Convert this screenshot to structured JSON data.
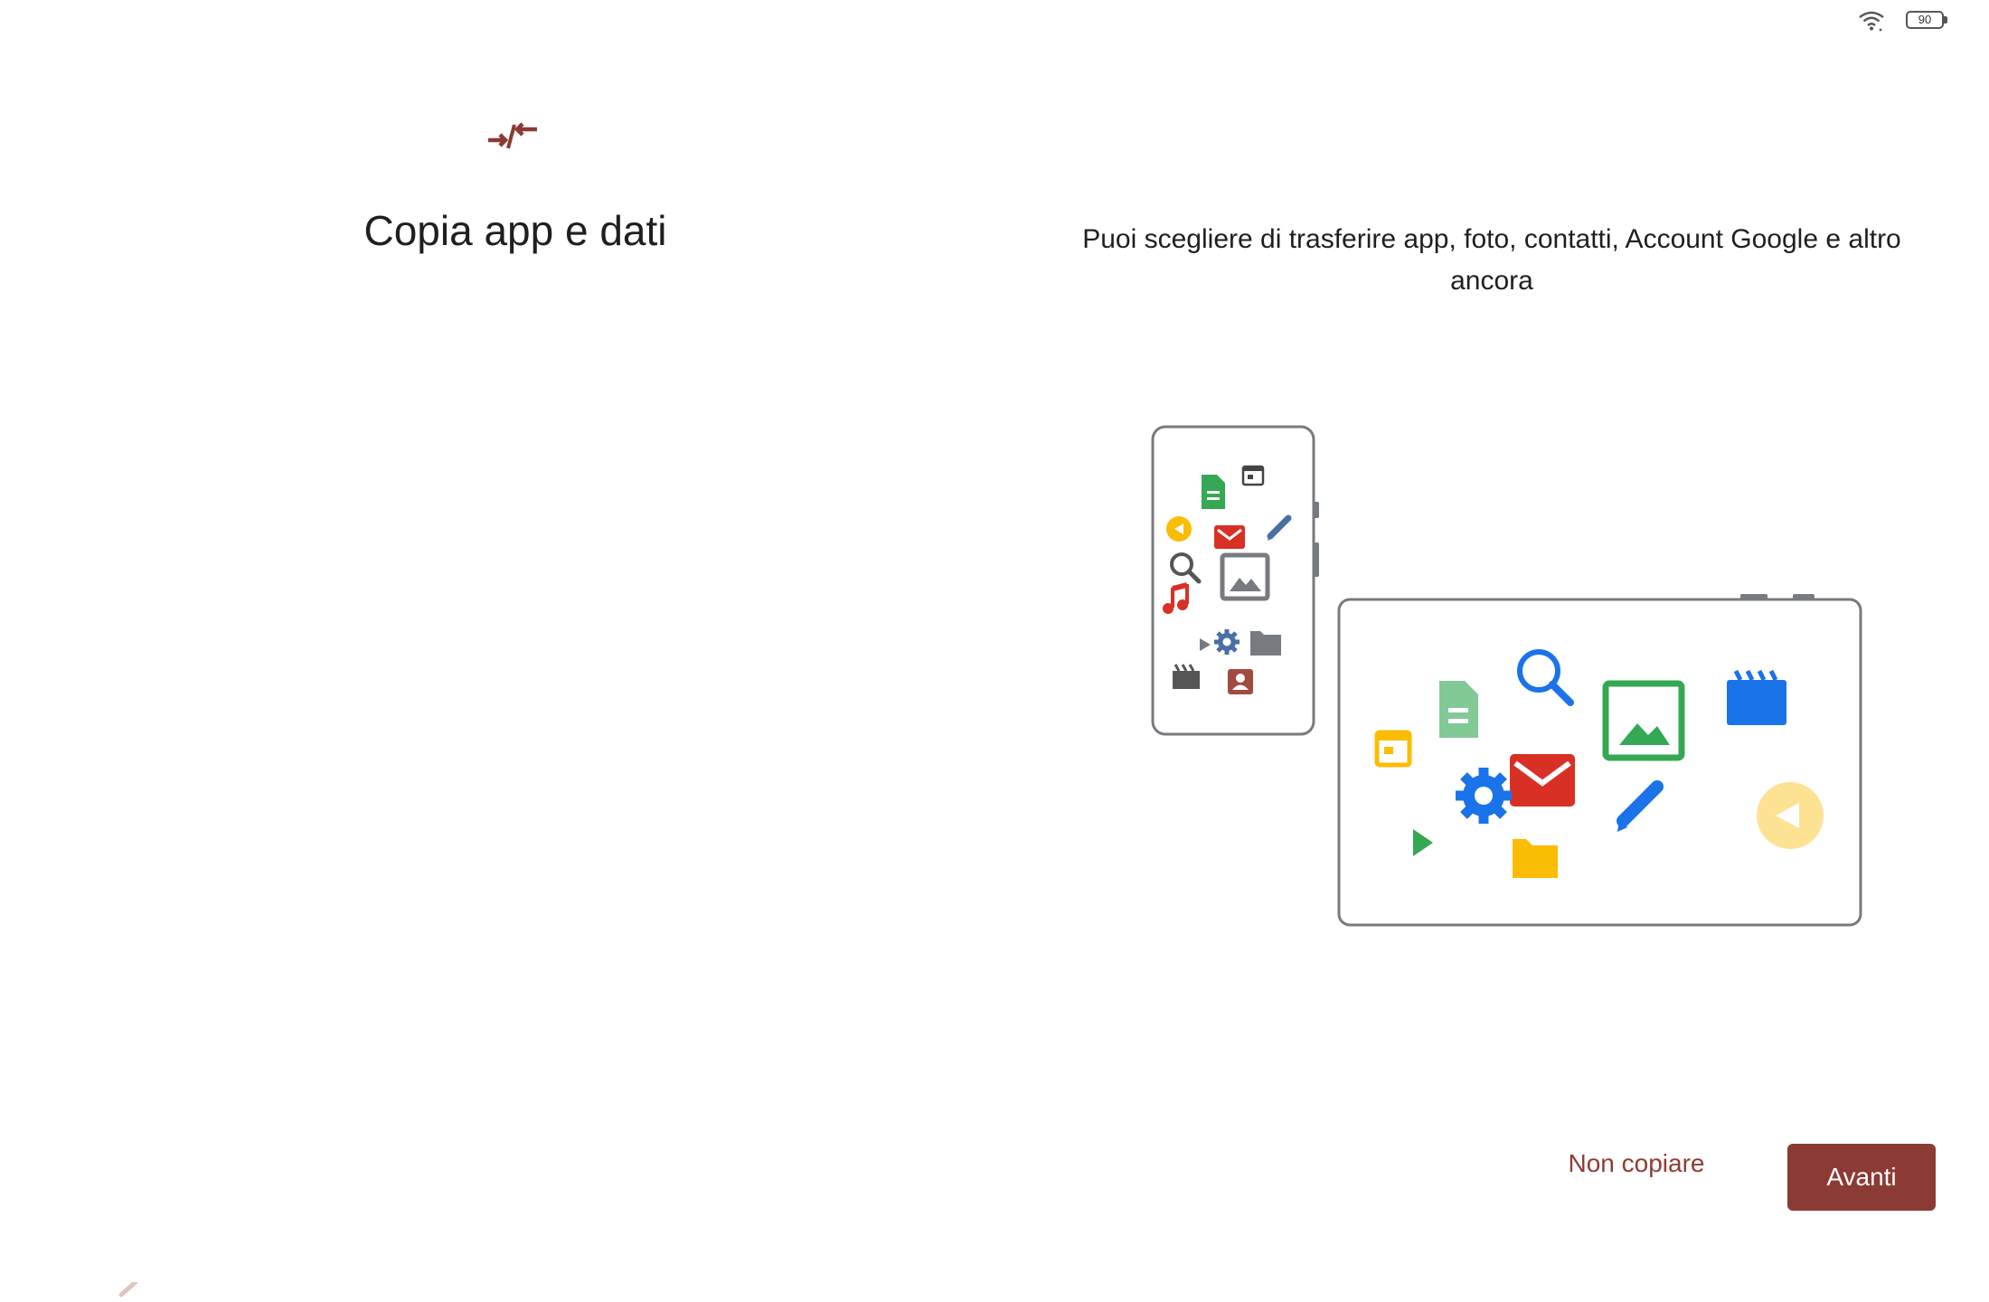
{
  "status_bar": {
    "wifi_icon": "wifi-icon",
    "battery_level": "90"
  },
  "header": {
    "icon": "copy-transfer-icon",
    "title": "Copia app e dati"
  },
  "main": {
    "description": "Puoi scegliere di trasferire app, foto, contatti, Account Google e altro ancora",
    "illustration": {
      "phone_icons": [
        "document-icon",
        "calendar-icon",
        "back-icon",
        "mail-icon",
        "pencil-icon",
        "search-icon",
        "image-icon",
        "music-icon",
        "play-icon",
        "gear-icon",
        "folder-icon",
        "clapperboard-icon",
        "contact-icon"
      ],
      "tablet_icons": [
        "calendar-icon",
        "document-icon",
        "search-icon",
        "image-icon",
        "clapperboard-icon",
        "mail-icon",
        "gear-icon",
        "pencil-icon",
        "back-icon",
        "play-icon",
        "folder-icon"
      ]
    }
  },
  "footer": {
    "skip_label": "Non copiare",
    "next_label": "Avanti"
  },
  "nav": {
    "back_icon": "chevron-left-icon"
  },
  "colors": {
    "accent": "#8c3a34",
    "accent_text": "#8f3b35",
    "device_outline": "#777a7e",
    "green": "#34a853",
    "blue": "#1a73e8",
    "red": "#d93025",
    "yellow": "#fbbc04"
  }
}
